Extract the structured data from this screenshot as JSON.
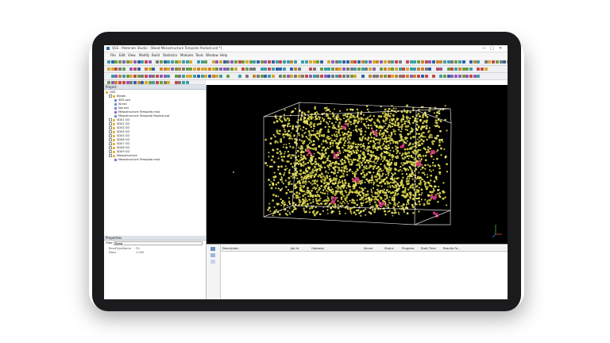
{
  "window": {
    "title": "QSS - Materials Studio - [Bead Mesostructure Template Packed.xsd *]",
    "controls": [
      "—",
      "□",
      "✕"
    ]
  },
  "menu": [
    "File",
    "Edit",
    "View",
    "Modify",
    "Build",
    "Statistics",
    "Modules",
    "Tools",
    "Window",
    "Help"
  ],
  "project": {
    "header": "Project",
    "root": "QSS",
    "folder": "Beads",
    "items": [
      "SDS.xsd",
      "W.xsd",
      "Nw.xsd",
      "Mesostructure Template.msd",
      "Mesostructure Template Packed.xsd"
    ],
    "groups": [
      "SDS1 GO",
      "SDS2 GO",
      "SDS3 GO",
      "SDS4 GO",
      "SDS5 GO",
      "SDS6 GO",
      "SDS7 GO",
      "SDS8 GO",
      "SDS9 GO"
    ],
    "meso_folder": "Mesostructure",
    "meso_item": "Mesostructure Template.msd"
  },
  "properties": {
    "header": "Properties",
    "filter_label": "Filter",
    "filter_value": "Bead",
    "rows": [
      {
        "name": "BeadTypeName",
        "value": "FX"
      },
      {
        "name": "Mass",
        "value": "1.000"
      }
    ]
  },
  "jobs": {
    "columns": [
      "Description",
      "Job Id",
      "Gateway",
      "Server",
      "Status",
      "Progress",
      "Start Time",
      "Results Fo..."
    ]
  },
  "viewport": {
    "background": "#000000",
    "bead_colors": [
      "#e5e06a",
      "#d9d44c",
      "#c3c24a",
      "#b8b23a"
    ],
    "accent_bead_color": "#d1357c"
  }
}
